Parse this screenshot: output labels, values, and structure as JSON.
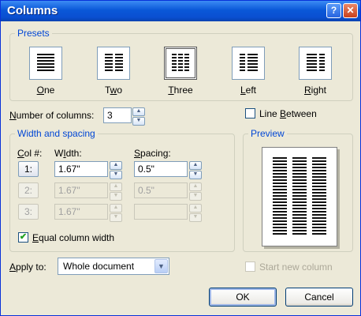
{
  "window": {
    "title": "Columns",
    "help_glyph": "?",
    "close_glyph": "✕"
  },
  "presets": {
    "group_label": "Presets",
    "items": [
      {
        "key": "one",
        "prefix": "",
        "mnemonic": "O",
        "rest": "ne",
        "selected": false
      },
      {
        "key": "two",
        "prefix": "T",
        "mnemonic": "w",
        "rest": "o",
        "selected": false
      },
      {
        "key": "three",
        "prefix": "",
        "mnemonic": "T",
        "rest": "hree",
        "selected": true
      },
      {
        "key": "left",
        "prefix": "",
        "mnemonic": "L",
        "rest": "eft",
        "selected": false
      },
      {
        "key": "right",
        "prefix": "",
        "mnemonic": "R",
        "rest": "ight",
        "selected": false
      }
    ]
  },
  "num_columns": {
    "label_mnemonic": "N",
    "label_rest": "umber of columns:",
    "value": "3"
  },
  "line_between": {
    "label_mnemonic": "B",
    "label_prefix": "Line ",
    "label_rest": "etween",
    "checked": false
  },
  "width_spacing": {
    "group_label": "Width and spacing",
    "col_header_mnemonic": "C",
    "col_header_rest": "ol #:",
    "width_header_mnemonic": "I",
    "width_header_prefix": "W",
    "width_header_rest": "dth:",
    "spacing_header_mnemonic": "S",
    "spacing_header_rest": "pacing:",
    "rows": [
      {
        "col": "1:",
        "width": "1.67\"",
        "spacing": "0.5\"",
        "enabled": true
      },
      {
        "col": "2:",
        "width": "1.67\"",
        "spacing": "0.5\"",
        "enabled": false
      },
      {
        "col": "3:",
        "width": "1.67\"",
        "spacing": "",
        "enabled": false
      }
    ],
    "equal_width": {
      "label_mnemonic": "E",
      "label_rest": "qual column width",
      "checked": true
    }
  },
  "preview": {
    "group_label": "Preview",
    "columns": 3
  },
  "apply_to": {
    "label_mnemonic": "A",
    "label_rest": "pply to:",
    "value": "Whole document"
  },
  "start_new_column": {
    "label": "Start new column",
    "checked": false,
    "enabled": false
  },
  "buttons": {
    "ok": "OK",
    "cancel": "Cancel"
  },
  "glyphs": {
    "spin_up": "▲",
    "spin_down": "▼",
    "dropdown": "▼",
    "check": "✔"
  }
}
